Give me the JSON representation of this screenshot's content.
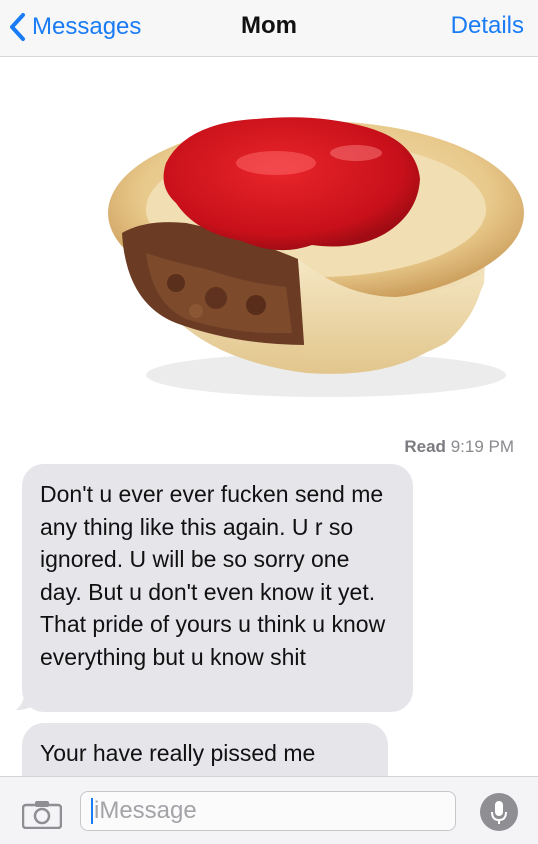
{
  "nav": {
    "back_label": "Messages",
    "title": "Mom",
    "details_label": "Details"
  },
  "status": {
    "read_label": "Read",
    "read_time": "9:19 PM"
  },
  "messages": [
    {
      "text": "Don't u ever ever fucken send me any thing like this again. U r so ignored. U will be so sorry one day. But u don't even know it yet. That pride of yours u think u know everything but u know shit"
    },
    {
      "text": "Your have really pissed me"
    }
  ],
  "composer": {
    "placeholder": "iMessage"
  },
  "colors": {
    "accent": "#1a7cf5",
    "received_bubble": "#e5e5ea"
  },
  "icons": [
    "chevron-left-icon",
    "camera-icon",
    "microphone-icon"
  ]
}
